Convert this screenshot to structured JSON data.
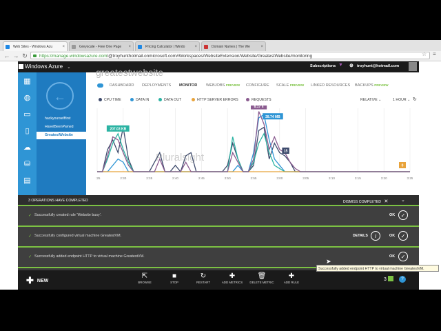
{
  "browser": {
    "tabs": [
      {
        "label": "Web Sites - Windows Azu"
      },
      {
        "label": "Greyscale - Free One Page"
      },
      {
        "label": "Pricing Calculator | Windo"
      },
      {
        "label": "Domain Names | The We"
      }
    ],
    "url_host": "https://manage.windowsazure.com",
    "url_path": "/@troyhunthotmail.onmicrosoft.com#Workspaces/WebsiteExtension/Website/GreatestWebsite/monitoring"
  },
  "portal": {
    "brand": "Windows Azure",
    "subscriptions": "Subscriptions",
    "user": "troyhunt@hotmail.com",
    "ghost_title": "greatestwebsite",
    "sites": [
      "hackyourselffirst",
      "HaveIBeenPwned",
      "GreatestWebsite"
    ],
    "tabs": [
      {
        "label": "DASHBOARD",
        "preview": ""
      },
      {
        "label": "DEPLOYMENTS",
        "preview": ""
      },
      {
        "label": "MONITOR",
        "preview": ""
      },
      {
        "label": "WEBJOBS",
        "preview": "PREVIEW"
      },
      {
        "label": "CONFIGURE",
        "preview": ""
      },
      {
        "label": "SCALE",
        "preview": "PREVIEW"
      },
      {
        "label": "LINKED RESOURCES",
        "preview": ""
      },
      {
        "label": "BACKUPS",
        "preview": "PREVIEW"
      }
    ],
    "metrics": [
      {
        "label": "CPU TIME",
        "color": "#3e4b6d"
      },
      {
        "label": "DATA IN",
        "color": "#2f95d5"
      },
      {
        "label": "DATA OUT",
        "color": "#2bb3a3"
      },
      {
        "label": "HTTP SERVER ERRORS",
        "color": "#e8a33b"
      },
      {
        "label": "REQUESTS",
        "color": "#8a5b8f"
      }
    ],
    "relative": "RELATIVE",
    "range": "1 HOUR",
    "watermark": "Pluralsight"
  },
  "chart_data": {
    "type": "line",
    "x": [
      "2:25",
      "2:30",
      "2:35",
      "2:40",
      "2:45",
      "2:50",
      "2:55",
      "3:00",
      "3:05",
      "3:10",
      "3:15",
      "3:20",
      "3:25"
    ],
    "callouts": [
      {
        "label": "207.03 KB",
        "series": "DATA OUT"
      },
      {
        "label": "8.17 s",
        "series": "REQUESTS"
      },
      {
        "label": "28.74 MB",
        "series": "DATA IN"
      },
      {
        "label": "15",
        "series": "CPU TIME"
      },
      {
        "label": "0",
        "series": "HTTP SERVER ERRORS"
      }
    ],
    "series": [
      {
        "name": "CPU TIME",
        "color": "#3e4b6d",
        "values": [
          0,
          0,
          0.35,
          0.5,
          0.3,
          0.7,
          0.2,
          0,
          0,
          0,
          0,
          0.15,
          0.3,
          0,
          0,
          0.1,
          0,
          0.25,
          0.3,
          0,
          0,
          0,
          0,
          0,
          0,
          0.1,
          0.45,
          0.2,
          0,
          0,
          0.1,
          0.65,
          0.7,
          0.2,
          0.45,
          0.3,
          0.25,
          0.15,
          0,
          0,
          0,
          0,
          0,
          0,
          0,
          0,
          0,
          0,
          0,
          0,
          0,
          0,
          0,
          0,
          0,
          0,
          0,
          0,
          0,
          0,
          0
        ]
      },
      {
        "name": "DATA IN",
        "color": "#2f95d5",
        "values": [
          0,
          0,
          0,
          0.1,
          0.2,
          0.15,
          0,
          0,
          0,
          0,
          0,
          0,
          0,
          0,
          0,
          0,
          0,
          0,
          0,
          0,
          0,
          0,
          0,
          0,
          0,
          0,
          0,
          0.1,
          0,
          0,
          0.3,
          0.85,
          0.9,
          0.5,
          0.2,
          0.1,
          0,
          0,
          0,
          0,
          0,
          0,
          0,
          0,
          0,
          0,
          0,
          0,
          0,
          0,
          0,
          0,
          0,
          0,
          0,
          0,
          0,
          0,
          0,
          0,
          0
        ]
      },
      {
        "name": "DATA OUT",
        "color": "#2bb3a3",
        "values": [
          0,
          0,
          0.2,
          0.45,
          0.6,
          0.35,
          0.15,
          0,
          0,
          0,
          0,
          0,
          0,
          0,
          0,
          0,
          0,
          0,
          0,
          0,
          0,
          0,
          0,
          0,
          0,
          0,
          0.55,
          0.2,
          0,
          0,
          0.15,
          0.45,
          0.6,
          0.3,
          0.1,
          0.05,
          0,
          0,
          0,
          0,
          0,
          0,
          0,
          0,
          0,
          0,
          0,
          0,
          0,
          0,
          0,
          0,
          0,
          0,
          0,
          0,
          0,
          0,
          0,
          0,
          0
        ]
      },
      {
        "name": "HTTP SERVER ERRORS",
        "color": "#e8a33b",
        "values": [
          0,
          0,
          0,
          0,
          0,
          0,
          0,
          0,
          0,
          0,
          0,
          0,
          0,
          0,
          0,
          0,
          0,
          0,
          0,
          0,
          0,
          0,
          0,
          0,
          0,
          0,
          0,
          0,
          0,
          0,
          0,
          0,
          0,
          0,
          0,
          0,
          0,
          0,
          0,
          0,
          0,
          0,
          0,
          0,
          0,
          0,
          0,
          0,
          0,
          0,
          0,
          0,
          0,
          0,
          0,
          0,
          0,
          0,
          0,
          0,
          0
        ]
      },
      {
        "name": "REQUESTS",
        "color": "#8a5b8f",
        "values": [
          0,
          0,
          0.25,
          0.55,
          0.5,
          0.3,
          0.1,
          0,
          0,
          0,
          0,
          0,
          0.2,
          0,
          0,
          0,
          0,
          0.15,
          0,
          0,
          0,
          0,
          0,
          0,
          0,
          0,
          0.3,
          0.15,
          0,
          0,
          0.2,
          0.95,
          0.75,
          0.35,
          0.55,
          0.35,
          0.3,
          0.15,
          0.05,
          0,
          0,
          0,
          0,
          0,
          0,
          0,
          0,
          0,
          0,
          0,
          0,
          0,
          0,
          0,
          0,
          0,
          0,
          0,
          0,
          0,
          0
        ]
      }
    ],
    "ylim": [
      0,
      1
    ],
    "grid": true
  },
  "operations": {
    "header": "3 OPERATIONS HAVE COMPLETED",
    "dismiss": "DISMISS COMPLETED",
    "rows": [
      {
        "msg": "Successfully created rule 'Website busy'.",
        "ok": "OK",
        "details": ""
      },
      {
        "msg": "Successfully configured virtual machine GreatestVM.",
        "ok": "OK",
        "details": "DETAILS"
      },
      {
        "msg": "Successfully added endpoint HTTP to virtual machine GreatestVM.",
        "ok": "OK",
        "details": ""
      }
    ]
  },
  "commands": {
    "new": "NEW",
    "items": [
      "BROWSE",
      "STOP",
      "RESTART",
      "ADD METRICS",
      "DELETE METRIC",
      "ADD RULE"
    ],
    "count": "3",
    "tooltip": "Successfully added endpoint HTTP to virtual machine GreatestVM."
  }
}
